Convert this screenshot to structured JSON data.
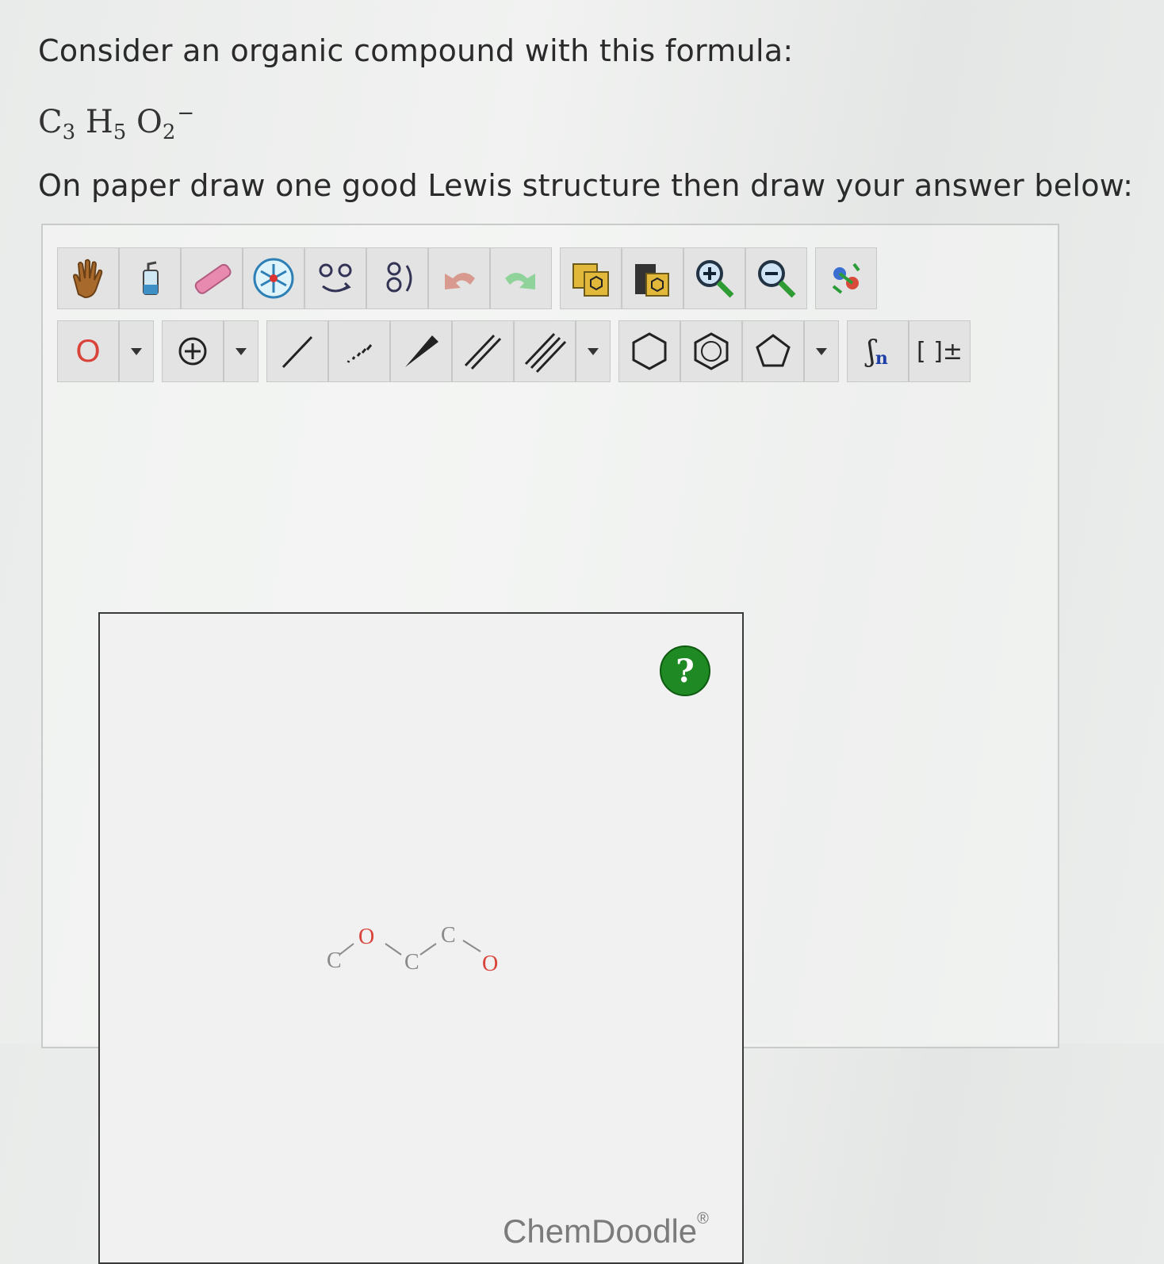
{
  "question": {
    "line1": "Consider an organic compound with this formula:",
    "formula": {
      "c": "C",
      "c_n": "3",
      "h": "H",
      "h_n": "5",
      "o": "O",
      "o_n": "2",
      "charge": "−"
    },
    "line2": "On paper draw one good Lewis structure then draw your answer below:"
  },
  "toolbar_row1": [
    {
      "icon": "hand-icon"
    },
    {
      "icon": "lasso-icon"
    },
    {
      "icon": "eraser-icon"
    },
    {
      "icon": "clean-icon"
    },
    {
      "icon": "flip-icon"
    },
    {
      "icon": "rotate-icon"
    },
    {
      "icon": "undo-icon"
    },
    {
      "icon": "redo-icon"
    },
    {
      "icon": "copy-icon"
    },
    {
      "icon": "paste-icon"
    },
    {
      "icon": "zoom-in-icon"
    },
    {
      "icon": "zoom-out-icon"
    },
    {
      "icon": "settings-icon"
    }
  ],
  "toolbar_row2": {
    "atom_label": "O",
    "bracket_label": "[ ]±",
    "repeat_label": "n"
  },
  "molecule": {
    "atoms": [
      "C",
      "O",
      "C",
      "C",
      "O"
    ]
  },
  "help_label": "?",
  "brand": {
    "name": "ChemDoodle",
    "mark": "®"
  },
  "colors": {
    "oxygen": "#d9433a",
    "help": "#1f8a23",
    "carbon": "#8a8a8a"
  }
}
